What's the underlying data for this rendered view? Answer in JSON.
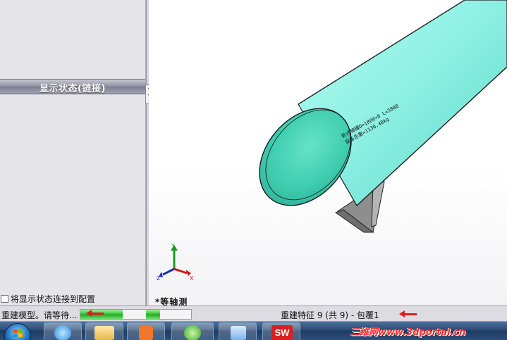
{
  "property_panel": {
    "header": "显示状态(链接)",
    "link_checkbox_label": "将显示状态连接到配置",
    "link_checkbox_checked": false
  },
  "viewport": {
    "view_orientation": "*等轴测",
    "model_engraving": {
      "line1": "卧式储罐D=1800×8 L=3000",
      "line2": "设备总重=1130.48kg"
    },
    "triad_axes": [
      "Y",
      "Z",
      "X"
    ],
    "colors": {
      "tank_body": "#8ff1e4",
      "tank_shadow": "#3fc8b6",
      "support": "#9a9a9a"
    }
  },
  "statusbar": {
    "left_text": "重建模型。请等待...",
    "progress_fraction": 0.72,
    "right_text": "重建特征 9 (共 9) - 包覆1"
  },
  "taskbar": {
    "watermark": "三维网www.3dportal.cn",
    "apps": [
      "start-orb",
      "internet-explorer",
      "file-explorer",
      "media-player",
      "sync-app",
      "gallery-app",
      "solidworks"
    ]
  },
  "annotations": {
    "arrow_color": "#e21b1b"
  }
}
